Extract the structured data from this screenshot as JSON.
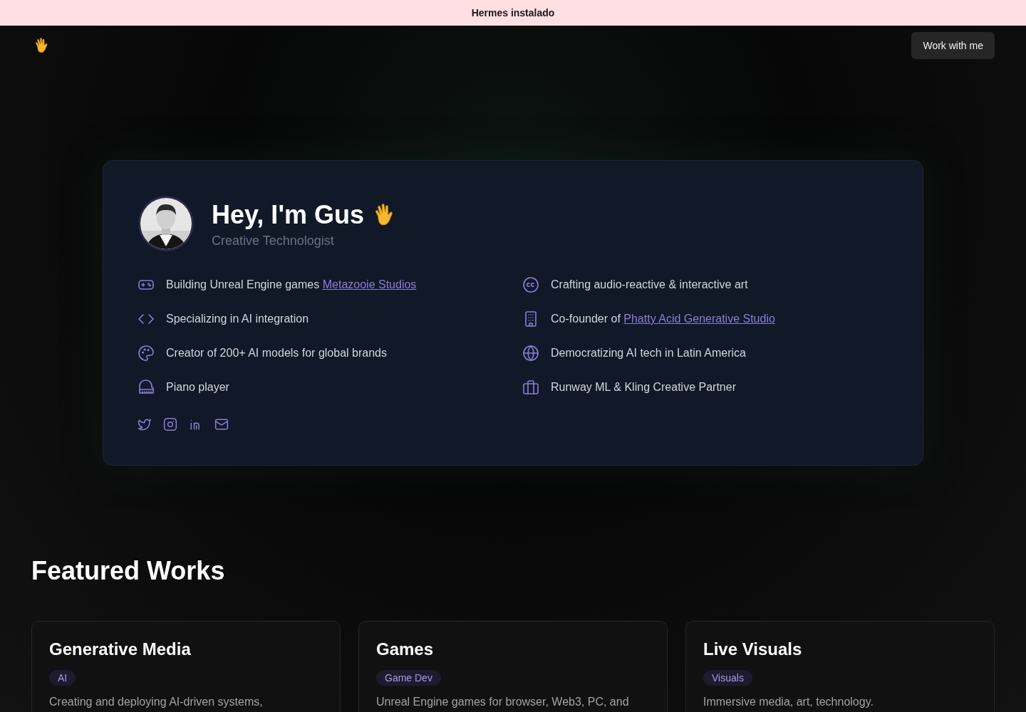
{
  "banner": {
    "text": "Hermes instalado"
  },
  "nav": {
    "button": "Work with me"
  },
  "profile": {
    "name": "Hey, I'm Gus",
    "role": "Creative Technologist",
    "facts": [
      {
        "kind": "gamepad",
        "text": "Building Unreal Engine games",
        "link": "Metazooie Studios"
      },
      {
        "kind": "cc",
        "text": "Crafting audio-reactive & interactive art"
      },
      {
        "kind": "code",
        "text": "Specializing in AI integration"
      },
      {
        "kind": "building",
        "text": "Co-founder of",
        "link": "Phatty Acid Generative Studio"
      },
      {
        "kind": "palette",
        "text": "Creator of 200+ AI models for global brands"
      },
      {
        "kind": "globe",
        "text": "Democratizing AI tech in Latin America"
      },
      {
        "kind": "piano",
        "text": "Piano player"
      },
      {
        "kind": "briefcase",
        "text": "Runway ML & Kling Creative Partner"
      }
    ],
    "socials": [
      {
        "kind": "twitter"
      },
      {
        "kind": "instagram"
      },
      {
        "kind": "linkedin"
      },
      {
        "kind": "mail"
      }
    ]
  },
  "featured": {
    "title": "Featured Works",
    "works": [
      {
        "title": "Generative Media",
        "tag": "AI",
        "description": "Creating and deploying AI-driven systems,"
      },
      {
        "title": "Games",
        "tag": "Game Dev",
        "description": "Unreal Engine games for browser, Web3, PC, and"
      },
      {
        "title": "Live Visuals",
        "tag": "Visuals",
        "description": "Immersive media, art, technology."
      }
    ]
  }
}
